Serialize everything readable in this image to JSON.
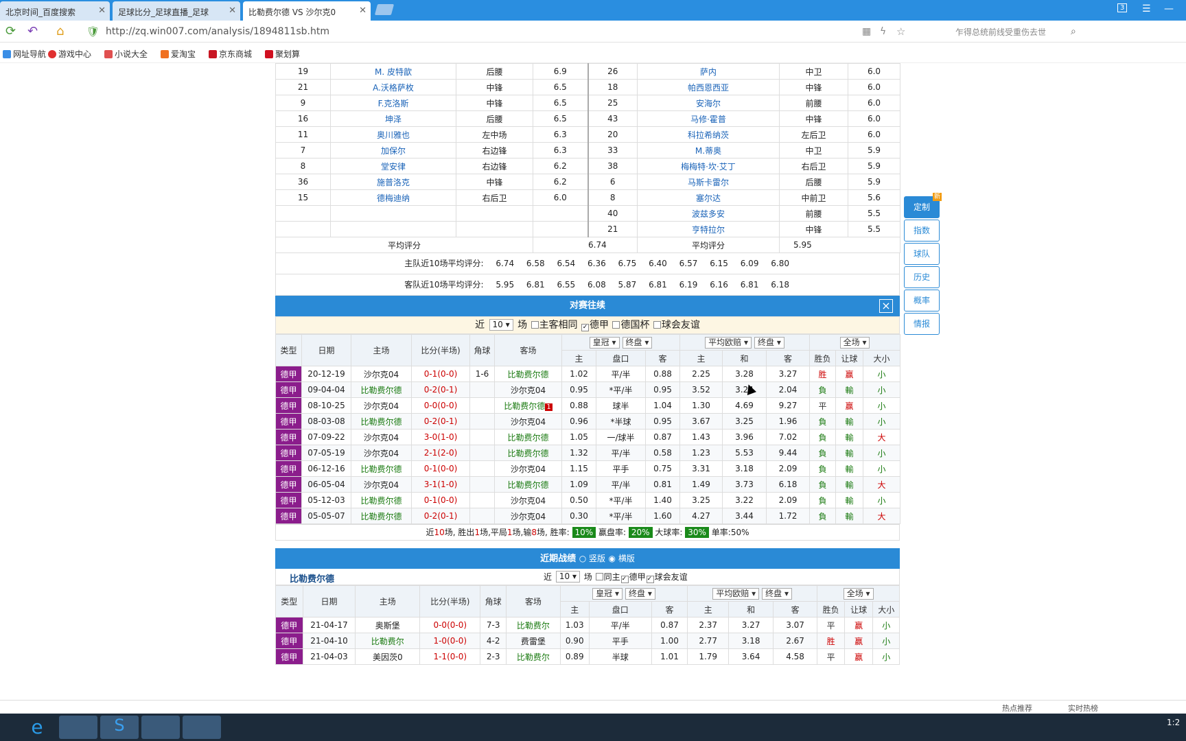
{
  "browser": {
    "tabs": [
      {
        "label": "北京时间_百度搜索"
      },
      {
        "label": "足球比分_足球直播_足球"
      },
      {
        "label": "比勒费尔德 VS 沙尔克0"
      }
    ],
    "tab_badge": "3",
    "url": "http://zq.win007.com/analysis/1894811sb.htm",
    "search_placeholder": "乍得总统前线受重伤去世",
    "bookmarks": [
      "网址导航",
      "游戏中心",
      "小说大全",
      "爱淘宝",
      "京东商城",
      "聚划算"
    ]
  },
  "players": {
    "rows": [
      {
        "ln": "19",
        "lname": "M. 皮特歆",
        "lpos": "后腰",
        "lr": "6.9",
        "rn": "26",
        "rname": "萨内",
        "rpos": "中卫",
        "rr": "6.0"
      },
      {
        "ln": "21",
        "lname": "A.沃格萨枚",
        "lpos": "中锋",
        "lr": "6.5",
        "rn": "18",
        "rname": "帕西恩西亚",
        "rpos": "中锋",
        "rr": "6.0"
      },
      {
        "ln": "9",
        "lname": "F.克洛斯",
        "lpos": "中锋",
        "lr": "6.5",
        "rn": "25",
        "rname": "安海尔",
        "rpos": "前腰",
        "rr": "6.0"
      },
      {
        "ln": "16",
        "lname": "坤泽",
        "lpos": "后腰",
        "lr": "6.5",
        "rn": "43",
        "rname": "马修·霍普",
        "rpos": "中锋",
        "rr": "6.0"
      },
      {
        "ln": "11",
        "lname": "奥川雅也",
        "lpos": "左中场",
        "lr": "6.3",
        "rn": "20",
        "rname": "科拉希纳茨",
        "rpos": "左后卫",
        "rr": "6.0"
      },
      {
        "ln": "7",
        "lname": "加保尔",
        "lpos": "右边锋",
        "lr": "6.3",
        "rn": "33",
        "rname": "M.蒂奥",
        "rpos": "中卫",
        "rr": "5.9"
      },
      {
        "ln": "8",
        "lname": "堂安律",
        "lpos": "右边锋",
        "lr": "6.2",
        "rn": "38",
        "rname": "梅梅特·坎·艾丁",
        "rpos": "右后卫",
        "rr": "5.9"
      },
      {
        "ln": "36",
        "lname": "施普洛克",
        "lpos": "中锋",
        "lr": "6.2",
        "rn": "6",
        "rname": "马斯卡雷尔",
        "rpos": "后腰",
        "rr": "5.9"
      },
      {
        "ln": "15",
        "lname": "德梅迪纳",
        "lpos": "右后卫",
        "lr": "6.0",
        "rn": "8",
        "rname": "塞尔达",
        "rpos": "中前卫",
        "rr": "5.6"
      },
      {
        "ln": "",
        "lname": "",
        "lpos": "",
        "lr": "",
        "rn": "40",
        "rname": "波兹多安",
        "rpos": "前腰",
        "rr": "5.5"
      },
      {
        "ln": "",
        "lname": "",
        "lpos": "",
        "lr": "",
        "rn": "21",
        "rname": "亨特拉尔",
        "rpos": "中锋",
        "rr": "5.5"
      }
    ],
    "avg_label": "平均评分",
    "home_avg": "6.74",
    "away_avg": "5.95",
    "home_hist_label": "主队近10场平均评分:",
    "home_hist": [
      "6.74",
      "6.58",
      "6.54",
      "6.36",
      "6.75",
      "6.40",
      "6.57",
      "6.15",
      "6.09",
      "6.80"
    ],
    "away_hist_label": "客队近10场平均评分:",
    "away_hist": [
      "5.95",
      "6.81",
      "6.55",
      "6.08",
      "5.87",
      "6.81",
      "6.19",
      "6.16",
      "6.81",
      "6.18"
    ]
  },
  "h2h": {
    "title": "对赛往续",
    "close_icon": "×",
    "filter": {
      "near": "近",
      "count": "10",
      "unit": "场",
      "opt1": "主客相同",
      "opt2": "德甲",
      "opt3": "德国杯",
      "opt4": "球会友谊"
    },
    "headers": {
      "type": "类型",
      "date": "日期",
      "home": "主场",
      "score": "比分(半场)",
      "corner": "角球",
      "away": "客场",
      "company": "皇冠",
      "final1": "终盘",
      "euro": "平均欧赔",
      "final2": "终盘",
      "scope": "全场",
      "h": "主",
      "pan": "盘口",
      "a": "客",
      "h2": "主",
      "d": "和",
      "a2": "客",
      "wl": "胜负",
      "rq": "让球",
      "dx": "大小"
    },
    "rows": [
      {
        "type": "德甲",
        "date": "20-12-19",
        "home": "沙尔克04",
        "score": "0-1(0-0)",
        "corner": "1-6",
        "away": "比勒费尔德",
        "o1": "1.02",
        "pan": "平/半",
        "o2": "0.88",
        "e1": "2.25",
        "e2": "3.28",
        "e3": "3.27",
        "wl": "胜",
        "rq": "赢",
        "dx": "小",
        "hg": 0
      },
      {
        "type": "德甲",
        "date": "09-04-04",
        "home": "比勒费尔德",
        "score": "0-2(0-1)",
        "corner": "",
        "away": "沙尔克04",
        "o1": "0.95",
        "pan": "*平/半",
        "o2": "0.95",
        "e1": "3.52",
        "e2": "3.24",
        "e3": "2.04",
        "wl": "負",
        "rq": "輸",
        "dx": "小",
        "hg": 1
      },
      {
        "type": "德甲",
        "date": "08-10-25",
        "home": "沙尔克04",
        "score": "0-0(0-0)",
        "corner": "",
        "away": "比勒费尔德",
        "o1": "0.88",
        "pan": "球半",
        "o2": "1.04",
        "e1": "1.30",
        "e2": "4.69",
        "e3": "9.27",
        "wl": "平",
        "rq": "赢",
        "dx": "小",
        "hg": 0,
        "card": "1"
      },
      {
        "type": "德甲",
        "date": "08-03-08",
        "home": "比勒费尔德",
        "score": "0-2(0-1)",
        "corner": "",
        "away": "沙尔克04",
        "o1": "0.96",
        "pan": "*半球",
        "o2": "0.95",
        "e1": "3.67",
        "e2": "3.25",
        "e3": "1.96",
        "wl": "負",
        "rq": "輸",
        "dx": "小",
        "hg": 1
      },
      {
        "type": "德甲",
        "date": "07-09-22",
        "home": "沙尔克04",
        "score": "3-0(1-0)",
        "corner": "",
        "away": "比勒费尔德",
        "o1": "1.05",
        "pan": "一/球半",
        "o2": "0.87",
        "e1": "1.43",
        "e2": "3.96",
        "e3": "7.02",
        "wl": "負",
        "rq": "輸",
        "dx": "大",
        "hg": 0
      },
      {
        "type": "德甲",
        "date": "07-05-19",
        "home": "沙尔克04",
        "score": "2-1(2-0)",
        "corner": "",
        "away": "比勒费尔德",
        "o1": "1.32",
        "pan": "平/半",
        "o2": "0.58",
        "e1": "1.23",
        "e2": "5.53",
        "e3": "9.44",
        "wl": "負",
        "rq": "輸",
        "dx": "小",
        "hg": 0
      },
      {
        "type": "德甲",
        "date": "06-12-16",
        "home": "比勒费尔德",
        "score": "0-1(0-0)",
        "corner": "",
        "away": "沙尔克04",
        "o1": "1.15",
        "pan": "平手",
        "o2": "0.75",
        "e1": "3.31",
        "e2": "3.18",
        "e3": "2.09",
        "wl": "負",
        "rq": "輸",
        "dx": "小",
        "hg": 1
      },
      {
        "type": "德甲",
        "date": "06-05-04",
        "home": "沙尔克04",
        "score": "3-1(1-0)",
        "corner": "",
        "away": "比勒费尔德",
        "o1": "1.09",
        "pan": "平/半",
        "o2": "0.81",
        "e1": "1.49",
        "e2": "3.73",
        "e3": "6.18",
        "wl": "負",
        "rq": "輸",
        "dx": "大",
        "hg": 0
      },
      {
        "type": "德甲",
        "date": "05-12-03",
        "home": "比勒费尔德",
        "score": "0-1(0-0)",
        "corner": "",
        "away": "沙尔克04",
        "o1": "0.50",
        "pan": "*平/半",
        "o2": "1.40",
        "e1": "3.25",
        "e2": "3.22",
        "e3": "2.09",
        "wl": "負",
        "rq": "輸",
        "dx": "小",
        "hg": 1
      },
      {
        "type": "德甲",
        "date": "05-05-07",
        "home": "比勒费尔德",
        "score": "0-2(0-1)",
        "corner": "",
        "away": "沙尔克04",
        "o1": "0.30",
        "pan": "*平/半",
        "o2": "1.60",
        "e1": "4.27",
        "e2": "3.44",
        "e3": "1.72",
        "wl": "負",
        "rq": "輸",
        "dx": "大",
        "hg": 1
      }
    ],
    "summary": {
      "p1": "近",
      "n": "10",
      "p2": "场, 胜出",
      "w": "1",
      "p3": "场,平局",
      "d": "1",
      "p4": "场,输",
      "l": "8",
      "p5": "场, 胜率:",
      "wr": "10%",
      "p6": "赢盘率:",
      "pr": "20%",
      "p7": "大球率:",
      "br": "30%",
      "p8": "单率:",
      "sr": "50%"
    }
  },
  "recent": {
    "title": "近期战绩",
    "radio1": "竖版",
    "radio2": "横版",
    "team": "比勒费尔德",
    "filter": {
      "near": "近",
      "count": "10",
      "unit": "场",
      "opt1": "同主",
      "opt2": "德甲",
      "opt3": "球会友谊"
    },
    "rows": [
      {
        "type": "德甲",
        "date": "21-04-17",
        "home": "奥斯堡",
        "score": "0-0(0-0)",
        "corner": "7-3",
        "away": "比勒费尔",
        "o1": "1.03",
        "pan": "平/半",
        "o2": "0.87",
        "e1": "2.37",
        "e2": "3.27",
        "e3": "3.07",
        "wl": "平",
        "rq": "赢",
        "dx": "小",
        "hg": 0
      },
      {
        "type": "德甲",
        "date": "21-04-10",
        "home": "比勒费尔",
        "score": "1-0(0-0)",
        "corner": "4-2",
        "away": "费雷堡",
        "o1": "0.90",
        "pan": "平手",
        "o2": "1.00",
        "e1": "2.77",
        "e2": "3.18",
        "e3": "2.67",
        "wl": "胜",
        "rq": "赢",
        "dx": "小",
        "hg": 1
      },
      {
        "type": "德甲",
        "date": "21-04-03",
        "home": "美因茨0",
        "score": "1-1(0-0)",
        "corner": "2-3",
        "away": "比勒费尔",
        "o1": "0.89",
        "pan": "半球",
        "o2": "1.01",
        "e1": "1.79",
        "e2": "3.64",
        "e3": "4.58",
        "wl": "平",
        "rq": "赢",
        "dx": "小",
        "hg": 0
      }
    ]
  },
  "side_buttons": [
    "定制",
    "指数",
    "球队",
    "历史",
    "概率",
    "情报"
  ],
  "side_badge": "新",
  "status": {
    "hot": "热点推荐",
    "live": "实时热榜"
  },
  "clock": "1:2"
}
